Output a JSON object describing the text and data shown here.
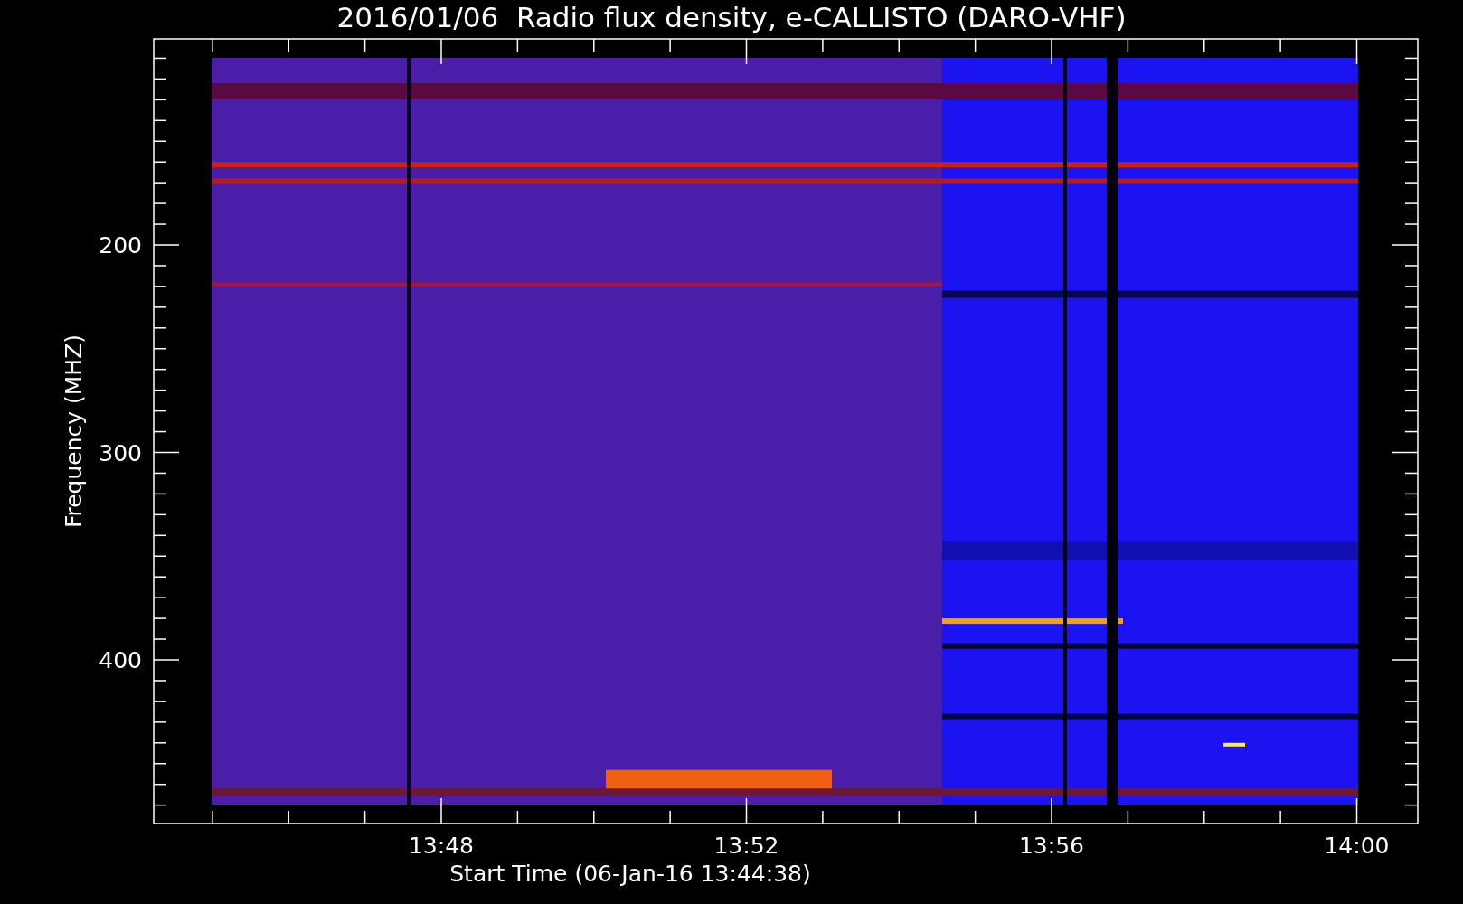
{
  "title": "2016/01/06  Radio flux density, e-CALLISTO (DARO-VHF)",
  "y_axis": {
    "label": "Frequency (MHZ)",
    "tick_labels": [
      "200",
      "300",
      "400"
    ]
  },
  "x_axis": {
    "label": "Start Time (06-Jan-16 13:44:38)",
    "tick_labels": [
      "13:48",
      "13:52",
      "13:56",
      "14:00"
    ]
  }
}
